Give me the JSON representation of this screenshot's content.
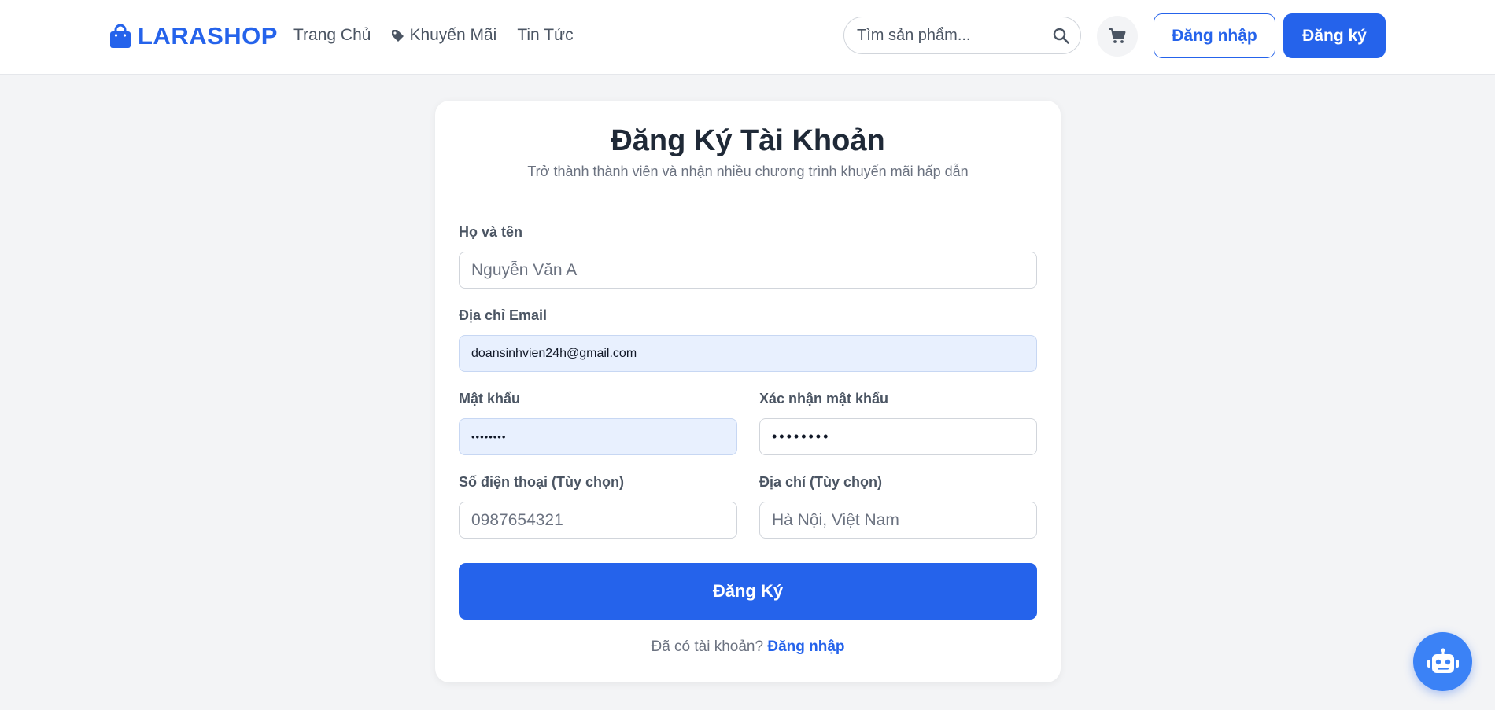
{
  "header": {
    "logo_text": "LARASHOP",
    "nav": [
      {
        "label": "Trang Chủ",
        "icon": ""
      },
      {
        "label": "Khuyến Mãi",
        "icon": "tag-icon"
      },
      {
        "label": "Tin Tức",
        "icon": ""
      }
    ],
    "search": {
      "placeholder": "Tìm sản phẩm...",
      "value": ""
    },
    "login_label": "Đăng nhập",
    "register_label": "Đăng ký"
  },
  "form": {
    "title": "Đăng Ký Tài Khoản",
    "subtitle": "Trở thành thành viên và nhận nhiều chương trình khuyến mãi hấp dẫn",
    "fullname": {
      "label": "Họ và tên",
      "placeholder": "Nguyễn Văn A",
      "value": ""
    },
    "email": {
      "label": "Địa chỉ Email",
      "value": "doansinhvien24h@gmail.com"
    },
    "password": {
      "label": "Mật khẩu",
      "masked": "••••••••"
    },
    "confirm_password": {
      "label": "Xác nhận mật khẩu",
      "masked": "••••••••"
    },
    "phone": {
      "label": "Số điện thoại (Tùy chọn)",
      "placeholder": "0987654321",
      "value": ""
    },
    "address": {
      "label": "Địa chỉ (Tùy chọn)",
      "placeholder": "Hà Nội, Việt Nam",
      "value": ""
    },
    "submit_label": "Đăng Ký",
    "footer_text": "Đã có tài khoản?",
    "footer_link": "Đăng nhập"
  },
  "colors": {
    "brand": "#2563eb",
    "background": "#f3f4f6",
    "autofill": "#e8f0fe"
  },
  "icons": {
    "logo": "shopping-bag-icon",
    "search": "search-icon",
    "cart": "cart-icon",
    "chatbot": "robot-icon"
  }
}
